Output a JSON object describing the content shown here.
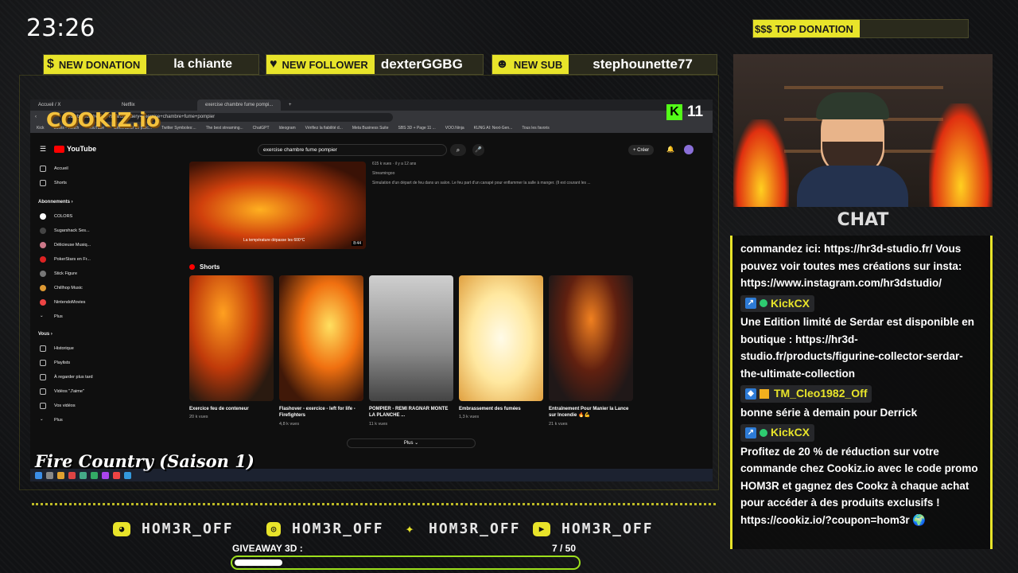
{
  "clock": "23:26",
  "alerts": {
    "donation": {
      "label": "NEW DONATION",
      "value": "la chiante"
    },
    "follower": {
      "label": "NEW FOLLOWER",
      "value": "dexterGGBG"
    },
    "sub": {
      "label": "NEW SUB",
      "value": "stephounette77"
    },
    "top": {
      "label": "TOP DONATION"
    }
  },
  "chat": {
    "title": "CHAT",
    "messages": [
      {
        "user": "",
        "text": "commandez ici: https://hr3d-studio.fr/ Vous pouvez voir toutes mes créations sur insta: https://www.instagram.com/hr3dstudio/"
      },
      {
        "user": "KickCX",
        "text": "Une Edition limité de Serdar est disponible en boutique : https://hr3d-studio.fr/products/figurine-collector-serdar-the-ultimate-collection"
      },
      {
        "user": "TM_Cleo1982_Off",
        "text": "bonne série à demain pour Derrick"
      },
      {
        "user": "KickCX",
        "text": "Profitez de 20 % de réduction sur votre commande chez Cookiz.io avec le code promo HOM3R et gagnez des Cookz à chaque achat pour accéder à des produits exclusifs ! https://cookiz.io/?coupon=hom3r 🌍"
      }
    ]
  },
  "browser": {
    "tabs": [
      "Accueil / X",
      "Netflix",
      "exercise chambre fume pompi...",
      "+"
    ],
    "url": "youtube.com/results?search_query=exercise+chambre+fume+pompier",
    "bookmarks": [
      "Kick",
      "Suivis - Twitch",
      "YouTube",
      "Générateur de polic...",
      "Twitter Symboles:...",
      "The best streaming...",
      "ChatGPT",
      "Ideogram",
      "Vérifiez la fiabilité d...",
      "Meta Business Suite",
      "SBS 3D + Page 11 ...",
      "VOO.Ninja",
      "KUNG AI: Next-Gen...",
      "Tous les favoris"
    ]
  },
  "youtube": {
    "logo": "YouTube",
    "search": "exercise chambre fume pompier",
    "create": "+ Créer",
    "sidebar": {
      "main": [
        "Accueil",
        "Shorts"
      ],
      "subs_title": "Abonnements  ›",
      "subs": [
        "COLORS",
        "Sugarshack Ses...",
        "Délicieuse Musiq...",
        "PokerStars en Fr...",
        "Stick Figure",
        "Chillhop Music",
        "NintendoMovies",
        "Plus"
      ],
      "you_title": "Vous  ›",
      "you": [
        "Historique",
        "Playlists",
        "À regarder plus tard",
        "Vidéos \"J'aime\"",
        "Vos vidéos",
        "Plus"
      ]
    },
    "video": {
      "views": "615 k vues · il y a 12 ans",
      "channel": "Streamingoo",
      "desc": "Simulation d'un départ de feu dans un salon. Le feu part d'un canapé pour enflammer la salle à manger. (Il est courant les ...",
      "caption": "La température dépasse les 600°C",
      "duration": "8:44"
    },
    "shorts_title": "Shorts",
    "shorts": [
      {
        "title": "Exercice feu de conteneur",
        "views": "20 k vues"
      },
      {
        "title": "Flashover - exercice - left for life - Firefighters",
        "views": "4,8 k vues"
      },
      {
        "title": "POMPIER - REMI RAGNAR MONTE LA PLANCHE ...",
        "views": "11 k vues"
      },
      {
        "title": "Embrassement des fumées",
        "views": "1,3 k vues"
      },
      {
        "title": "Entraînement Pour Manier la Lance sur Incendie 🔥💪",
        "views": "21 k vues"
      }
    ],
    "more": "Plus ⌄"
  },
  "overlay": {
    "sponsor": "COOKIZ.io",
    "kick_count": "11",
    "show": "Fire Country (Saison 1)",
    "socials": [
      "HOM3R_OFF",
      "HOM3R_OFF",
      "HOM3R_OFF",
      "HOM3R_OFF"
    ],
    "giveaway_label": "GIVEAWAY 3D :",
    "giveaway_count": "7  / 50",
    "giveaway_progress": 0.14
  },
  "colors": {
    "accent": "#e8e42a",
    "progress_border": "#9de01c",
    "kick": "#53fc18"
  }
}
